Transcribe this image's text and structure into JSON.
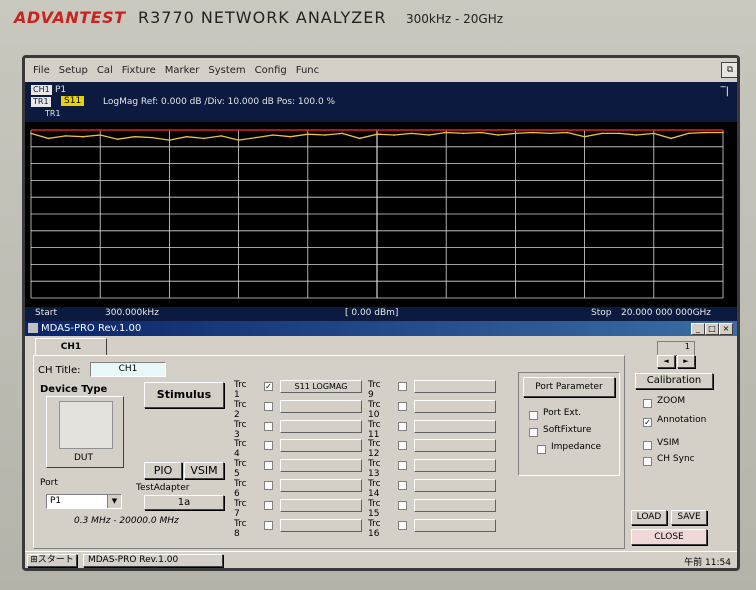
{
  "bezel": {
    "brand": "ADVANTEST",
    "model": "R3770  NETWORK  ANALYZER",
    "range": "300kHz - 20GHz"
  },
  "menu": [
    "File",
    "Setup",
    "Cal",
    "Fixture",
    "Marker",
    "System",
    "Config",
    "Func"
  ],
  "analyzer": {
    "ch_label": "CH1",
    "port_label": "P1",
    "trace_label": "TR1",
    "param": "S11",
    "trace_sub": "TR1",
    "format_line": "LogMag  Ref:  0.000 dB  /Div: 10.000 dB  Pos: 100.0 %",
    "start_label": "Start",
    "start_value": "300.000kHz",
    "power": "[   0.00 dBm]",
    "stop_label": "Stop",
    "stop_value": "20.000 000 000GHz"
  },
  "colors": {
    "trace": "#f0c040",
    "ref_line": "#e02020",
    "grid": "#d8d8d8",
    "title_bar": "#0a246a"
  },
  "chart_data": {
    "type": "line",
    "xlabel": "",
    "ylabel": "",
    "x": [
      0.0003,
      0.5,
      1.0,
      1.5,
      2.0,
      2.5,
      3.0,
      3.5,
      4.0,
      4.5,
      5.0,
      5.5,
      6.0,
      6.5,
      7.0,
      7.5,
      8.0,
      8.5,
      9.0,
      9.5,
      10.0,
      10.5,
      11.0,
      11.5,
      12.0,
      12.5,
      13.0,
      13.5,
      14.0,
      14.5,
      15.0,
      15.5,
      16.0,
      16.5,
      17.0,
      17.5,
      18.0,
      18.5,
      19.0,
      19.5,
      20.0
    ],
    "series": [
      {
        "values": [
          -2,
          -5,
          -3.5,
          -4,
          -3,
          -5.5,
          -4,
          -4.5,
          -6,
          -4,
          -5,
          -3.5,
          -6,
          -4.5,
          -3,
          -4,
          -2.5,
          -3,
          -2,
          -5,
          -2.5,
          -3,
          -2,
          -3,
          -1.5,
          -2,
          -1.5,
          -3,
          -2,
          -1.5,
          -2,
          -1.5,
          -4,
          -2,
          -2,
          -3,
          -2,
          -5,
          -2,
          -1.5,
          -1.5
        ]
      }
    ],
    "xlim": [
      0.0003,
      20.0
    ],
    "ylim": [
      -100,
      0
    ],
    "grid": true
  },
  "dialog": {
    "title": "MDAS-PRO Rev.1.00",
    "tab": "CH1",
    "ch_title_label": "CH Title:",
    "ch_title_value": "CH1",
    "device_type_label": "Device Type",
    "dut_label": "DUT",
    "stimulus_label": "Stimulus",
    "pio_label": "PIO",
    "vsim_btn_label": "VSIM",
    "port_label": "Port",
    "port_value": "P1",
    "test_adapter_label": "TestAdapter",
    "test_adapter_value": "1a",
    "freq_range": "0.3 MHz  -  20000.0 MHz",
    "traces_left": [
      {
        "label": "Trc 1",
        "checked": true,
        "value": "S11 LOGMAG"
      },
      {
        "label": "Trc 2",
        "checked": false,
        "value": ""
      },
      {
        "label": "Trc 3",
        "checked": false,
        "value": ""
      },
      {
        "label": "Trc 4",
        "checked": false,
        "value": ""
      },
      {
        "label": "Trc 5",
        "checked": false,
        "value": ""
      },
      {
        "label": "Trc 6",
        "checked": false,
        "value": ""
      },
      {
        "label": "Trc 7",
        "checked": false,
        "value": ""
      },
      {
        "label": "Trc 8",
        "checked": false,
        "value": ""
      }
    ],
    "traces_right": [
      {
        "label": "Trc 9",
        "checked": false,
        "value": ""
      },
      {
        "label": "Trc 10",
        "checked": false,
        "value": ""
      },
      {
        "label": "Trc 11",
        "checked": false,
        "value": ""
      },
      {
        "label": "Trc 12",
        "checked": false,
        "value": ""
      },
      {
        "label": "Trc 13",
        "checked": false,
        "value": ""
      },
      {
        "label": "Trc 14",
        "checked": false,
        "value": ""
      },
      {
        "label": "Trc 15",
        "checked": false,
        "value": ""
      },
      {
        "label": "Trc 16",
        "checked": false,
        "value": ""
      }
    ],
    "port_parameter_label": "Port Parameter",
    "port_ext_label": "Port Ext.",
    "softfixture_label": "SoftFixture",
    "impedance_label": "Impedance",
    "calibration_label": "Calibration",
    "zoom_label": "ZOOM",
    "zoom_checked": false,
    "annotation_label": "Annotation",
    "annotation_checked": true,
    "vsim_label": "VSIM",
    "vsim_checked": false,
    "chsync_label": "CH Sync",
    "chsync_checked": false,
    "load_label": "LOAD",
    "save_label": "SAVE",
    "close_label": "CLOSE",
    "spin_value": "1"
  },
  "taskbar": {
    "start_label": "スタート",
    "task_label": "MDAS-PRO Rev.1.00",
    "clock": "午前 11:54"
  }
}
